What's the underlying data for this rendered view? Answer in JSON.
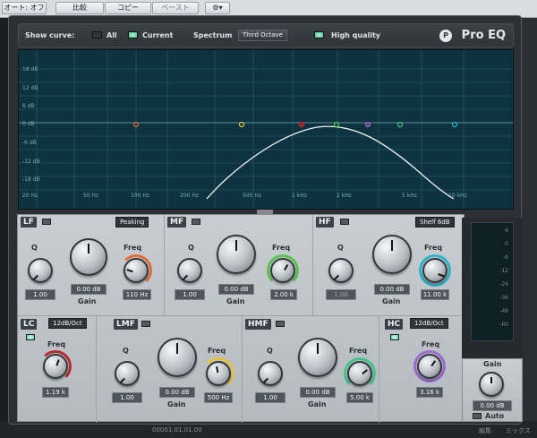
{
  "host": {
    "auto": "オート: オフ",
    "compare": "比較",
    "copy": "コピー",
    "paste": "ペースト"
  },
  "top": {
    "show_curve": "Show curve:",
    "all": "All",
    "current": "Current",
    "spectrum": "Spectrum",
    "spectrum_mode": "Third Octave",
    "high_quality": "High quality",
    "logo": "Pro EQ"
  },
  "graph": {
    "db_labels": [
      "18 dB",
      "12 dB",
      "6 dB",
      "0 dB",
      "-6 dB",
      "-12 dB",
      "-18 dB"
    ],
    "freq_labels": [
      "20 Hz",
      "50 Hz",
      "100 Hz",
      "200 Hz",
      "500 Hz",
      "1 kHz",
      "2 kHz",
      "5 kHz",
      "10 kHz"
    ]
  },
  "bands": {
    "lf": {
      "name": "LF",
      "mode": "Peaking",
      "q_label": "Q",
      "q": "1.00",
      "gain_label": "Gain",
      "gain": "0.00 dB",
      "freq_label": "Freq",
      "freq": "110 Hz"
    },
    "mf": {
      "name": "MF",
      "q_label": "Q",
      "q": "1.00",
      "gain_label": "Gain",
      "gain": "0.00 dB",
      "freq_label": "Freq",
      "freq": "2.00 k"
    },
    "hf": {
      "name": "HF",
      "mode": "Shelf 6dB",
      "q_label": "Q",
      "q": "1.00",
      "gain_label": "Gain",
      "gain": "0.00 dB",
      "freq_label": "Freq",
      "freq": "11.00 k"
    },
    "lc": {
      "name": "LC",
      "mode": "12dB/Oct",
      "freq_label": "Freq",
      "freq": "1.19 k"
    },
    "lmf": {
      "name": "LMF",
      "q_label": "Q",
      "q": "1.00",
      "gain_label": "Gain",
      "gain": "0.00 dB",
      "freq_label": "Freq",
      "freq": "500 Hz"
    },
    "hmf": {
      "name": "HMF",
      "q_label": "Q",
      "q": "1.00",
      "gain_label": "Gain",
      "gain": "0.00 dB",
      "freq_label": "Freq",
      "freq": "5.00 k"
    },
    "hc": {
      "name": "HC",
      "mode": "12dB/Oct",
      "freq_label": "Freq",
      "freq": "3.16 k"
    }
  },
  "meter": {
    "scale": [
      "6",
      "0",
      "-6",
      "-12",
      "-24",
      "-36",
      "-48",
      "-60"
    ]
  },
  "output": {
    "gain_label": "Gain",
    "gain": "0.00 dB",
    "auto": "Auto"
  },
  "bottom": {
    "left": "00001.01.01.00",
    "mix": "ミックス",
    "edit": "編集"
  }
}
